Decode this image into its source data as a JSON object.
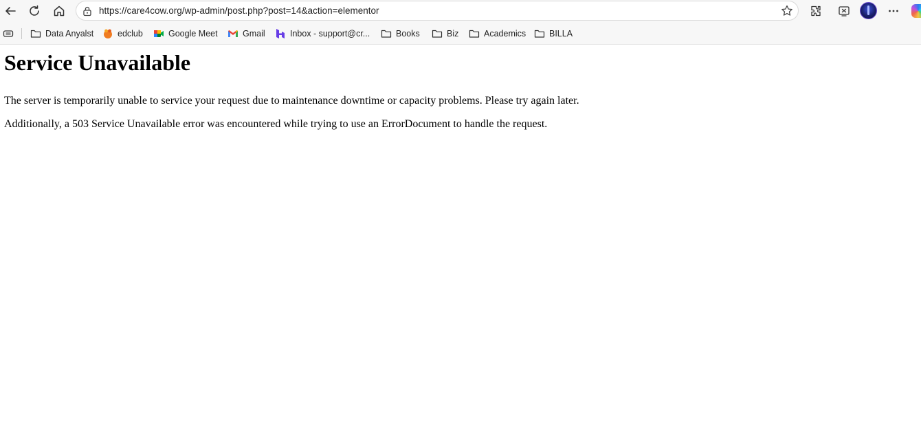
{
  "browser": {
    "url": "https://care4cow.org/wp-admin/post.php?post=14&action=elementor",
    "icons": {
      "back": "back-arrow-icon",
      "reload": "reload-icon",
      "home": "home-icon",
      "lock": "site-info-icon",
      "favorite": "star-icon",
      "extensions": "extensions-icon",
      "split_screen": "split-screen-icon",
      "profile": "profile-avatar",
      "more": "more-menu-icon",
      "copilot": "copilot-icon"
    }
  },
  "bookmarks": {
    "items": [
      {
        "label": "Data Anyalst",
        "icon": "folder-icon"
      },
      {
        "label": "edclub",
        "icon": "edclub-icon"
      },
      {
        "label": "Google Meet",
        "icon": "google-meet-icon"
      },
      {
        "label": "Gmail",
        "icon": "gmail-icon"
      },
      {
        "label": "Inbox - support@cr...",
        "icon": "hostinger-icon"
      },
      {
        "label": "Books",
        "icon": "folder-icon"
      },
      {
        "label": "Biz",
        "icon": "folder-icon"
      },
      {
        "label": "Academics",
        "icon": "folder-icon"
      },
      {
        "label": "BILLA",
        "icon": "folder-icon"
      }
    ]
  },
  "page": {
    "heading": "Service Unavailable",
    "paragraph1": "The server is temporarily unable to service your request due to maintenance downtime or capacity problems. Please try again later.",
    "paragraph2": "Additionally, a 503 Service Unavailable error was encountered while trying to use an ErrorDocument to handle the request."
  },
  "colors": {
    "toolbar_bg": "#f7f7f7",
    "page_bg": "#ffffff",
    "text": "#000000"
  }
}
